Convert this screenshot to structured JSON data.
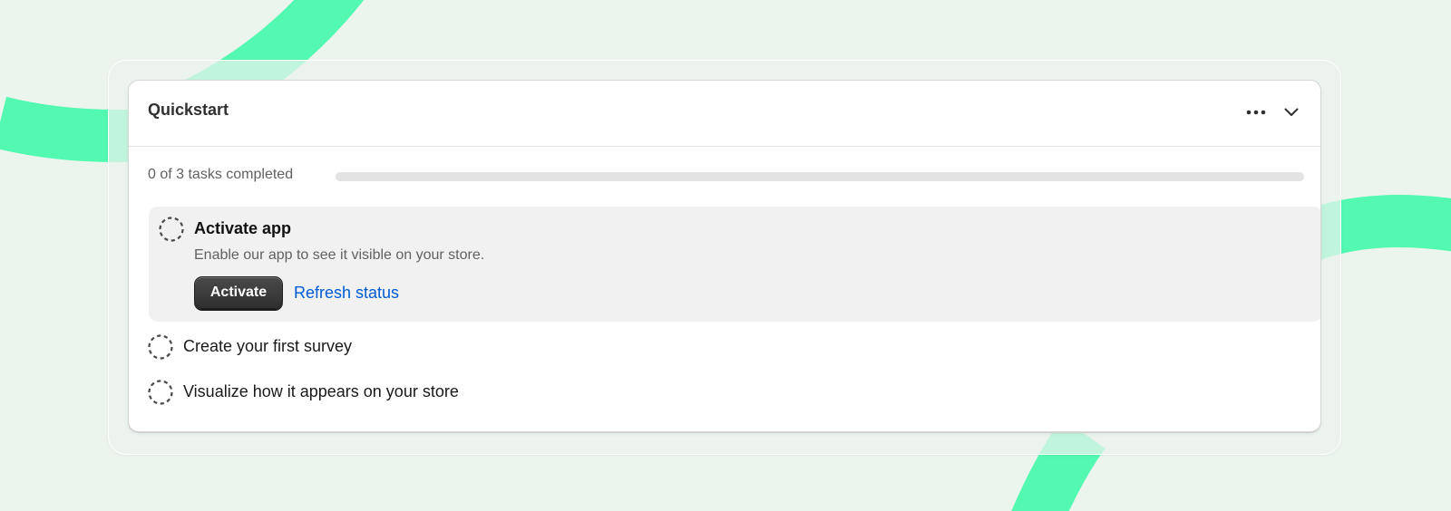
{
  "card": {
    "title": "Quickstart",
    "header_actions": [
      {
        "name": "more-actions",
        "icon": "ellipsis-horizontal-icon"
      },
      {
        "name": "collapse",
        "icon": "chevron-down-icon"
      }
    ]
  },
  "progress": {
    "label": "0 of 3 tasks completed",
    "completed": 0,
    "total": 3,
    "fraction": 0
  },
  "tasks": [
    {
      "title": "Activate app",
      "description": "Enable our app to see it visible on your store.",
      "status_icon": "incomplete-dashed-circle-icon",
      "primary_action": "Activate",
      "secondary_action": "Refresh status",
      "expanded": true
    },
    {
      "title": "Create your first survey",
      "status_icon": "incomplete-dashed-circle-icon",
      "expanded": false
    },
    {
      "title": "Visualize how it appears on your store",
      "status_icon": "incomplete-dashed-circle-icon",
      "expanded": false
    }
  ],
  "colors": {
    "page_background": "#ebf5ed",
    "decor_stripe": "#53f8b1",
    "card_background": "#ffffff",
    "active_task_background": "#f1f1f1",
    "primary_button": "#303030",
    "link": "#005bd3",
    "progress_track": "#e3e3e3"
  }
}
